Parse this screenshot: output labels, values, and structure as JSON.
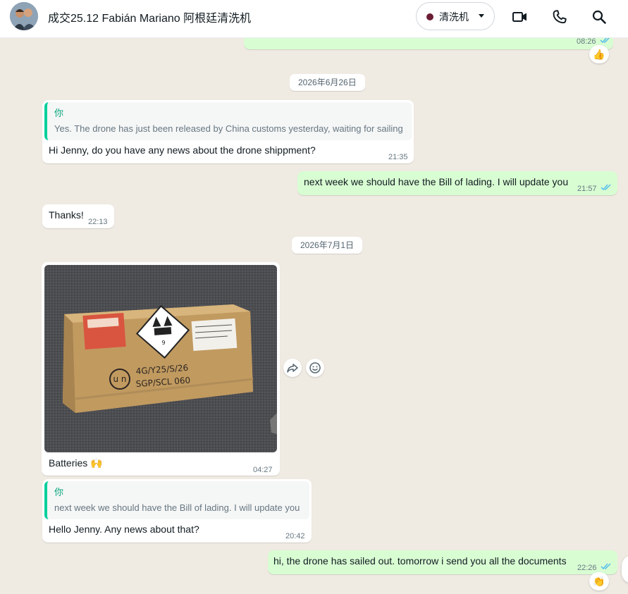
{
  "header": {
    "title": "成交25.12 Fabián Mariano 阿根廷清洗机",
    "label": "清洗机",
    "label_color": "#6b1d34"
  },
  "messages": {
    "m0": {
      "time": "08:26",
      "reaction": "👍"
    },
    "date1": "2026年6月26日",
    "m1": {
      "quote_author": "你",
      "quote_text": "Yes. The drone has just been released by China customs yesterday, waiting for sailing",
      "text": "Hi Jenny, do you have any news about the drone shippment?",
      "time": "21:35"
    },
    "m2": {
      "text": "next week we should have the Bill of lading. I will update you",
      "time": "21:57"
    },
    "m3": {
      "text": "Thanks!",
      "time": "22:13"
    },
    "date2": "2026年7月1日",
    "m4": {
      "image_alt": "cardboard box of batteries with hazard label",
      "box_marking_1": "4G/Y25/S/26",
      "box_marking_2": "SGP/SCL 060",
      "un_mark": "u n",
      "text": "Batteries 🙌",
      "time": "04:27"
    },
    "m5": {
      "quote_author": "你",
      "quote_text": "next week we should have the Bill of lading. I will update you",
      "text": "Hello Jenny. Any news about that?",
      "time": "20:42"
    },
    "m6": {
      "text": "hi, the drone has sailed out. tomorrow i send you all the documents",
      "time": "22:26",
      "reaction": "👏"
    }
  },
  "colors": {
    "outgoing_bubble": "#d9fdd3",
    "incoming_bubble": "#ffffff",
    "chat_background": "#efeae2",
    "read_ticks": "#53bdeb",
    "quote_accent": "#06cf9c"
  }
}
